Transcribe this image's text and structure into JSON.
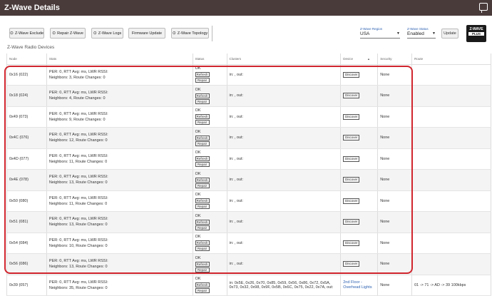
{
  "app": {
    "title": "Z-Wave Details"
  },
  "toolbar": {
    "buttons": [
      {
        "icon": "⊙",
        "label": "Z-Wave Exclude"
      },
      {
        "icon": "⊙",
        "label": "Repair Z-Wave"
      },
      {
        "icon": "⊙",
        "label": "Z-Wave Logs"
      },
      {
        "icon": "",
        "label": "Firmware Update"
      },
      {
        "icon": "⊙",
        "label": "Z-Wave Topology"
      }
    ],
    "region_label": "Z-Wave Region",
    "region_value": "USA",
    "status_label": "Z-Wave Status",
    "status_value": "Enabled",
    "update_label": "Update",
    "logo_text_top": "Z-WAVE",
    "logo_text_bottom": "PLUS"
  },
  "section": {
    "title": "Z-Wave Radio Devices"
  },
  "table": {
    "headers": [
      "Node",
      "Stats",
      "Status",
      "Clusters",
      "Device",
      "Security",
      "Route"
    ],
    "status_text": "OK",
    "refresh_label": "Refresh",
    "repair_label": "Repair",
    "discover_label": "Discover",
    "rows": [
      {
        "node": "0x16 (022)",
        "stats1": "PER: 0, RTT Avg: ms, LWR RSSI:",
        "stats2": "Neighbors: 3, Route Changes: 0",
        "clusters": "in: , out:",
        "security": "None",
        "route": ""
      },
      {
        "node": "0x18 (024)",
        "stats1": "PER: 0, RTT Avg: ms, LWR RSSI:",
        "stats2": "Neighbors: 4, Route Changes: 0",
        "clusters": "in: , out:",
        "security": "None",
        "route": ""
      },
      {
        "node": "0x49 (073)",
        "stats1": "PER: 0, RTT Avg: ms, LWR RSSI:",
        "stats2": "Neighbors: 9, Route Changes: 0",
        "clusters": "in: , out:",
        "security": "None",
        "route": ""
      },
      {
        "node": "0x4C (076)",
        "stats1": "PER: 0, RTT Avg: ms, LWR RSSI:",
        "stats2": "Neighbors: 12, Route Changes: 0",
        "clusters": "in: , out:",
        "security": "None",
        "route": ""
      },
      {
        "node": "0x4D (077)",
        "stats1": "PER: 0, RTT Avg: ms, LWR RSSI:",
        "stats2": "Neighbors: 11, Route Changes: 0",
        "clusters": "in: , out:",
        "security": "None",
        "route": ""
      },
      {
        "node": "0x4E (078)",
        "stats1": "PER: 0, RTT Avg: ms, LWR RSSI:",
        "stats2": "Neighbors: 13, Route Changes: 0",
        "clusters": "in: , out:",
        "security": "None",
        "route": ""
      },
      {
        "node": "0x50 (080)",
        "stats1": "PER: 0, RTT Avg: ms, LWR RSSI:",
        "stats2": "Neighbors: 11, Route Changes: 0",
        "clusters": "in: , out:",
        "security": "None",
        "route": ""
      },
      {
        "node": "0x51 (081)",
        "stats1": "PER: 0, RTT Avg: ms, LWR RSSI:",
        "stats2": "Neighbors: 13, Route Changes: 0",
        "clusters": "in: , out:",
        "security": "None",
        "route": ""
      },
      {
        "node": "0x54 (084)",
        "stats1": "PER: 0, RTT Avg: ms, LWR RSSI:",
        "stats2": "Neighbors: 10, Route Changes: 0",
        "clusters": "in: , out:",
        "security": "None",
        "route": ""
      },
      {
        "node": "0x56 (086)",
        "stats1": "PER: 0, RTT Avg: ms, LWR RSSI:",
        "stats2": "Neighbors: 13, Route Changes: 0",
        "clusters": "in: , out:",
        "security": "None",
        "route": ""
      },
      {
        "node": "0x39 (057)",
        "stats1": "PER: 0, RTT Avg: ms, LWR RSSI:",
        "stats2": "Neighbors: 35, Route Changes: 0",
        "clusters": "in: 0x5E, 0x26, 0x70, 0x85, 0x59, 0x56, 0x86, 0x72, 0x5A, 0x73, 0x32, 0x98, 0x9F, 0x5B, 0x6C, 0x75, 0x22, 0x7A, out:",
        "device_name": "2nd Floor - Overhead Lights",
        "security": "None",
        "route": "01 -> 71 -> AD -> 39 100kbps"
      }
    ]
  },
  "colors": {
    "titlebar": "#4a3b3b",
    "link": "#2a5fb0",
    "highlight": "#d0262e"
  }
}
